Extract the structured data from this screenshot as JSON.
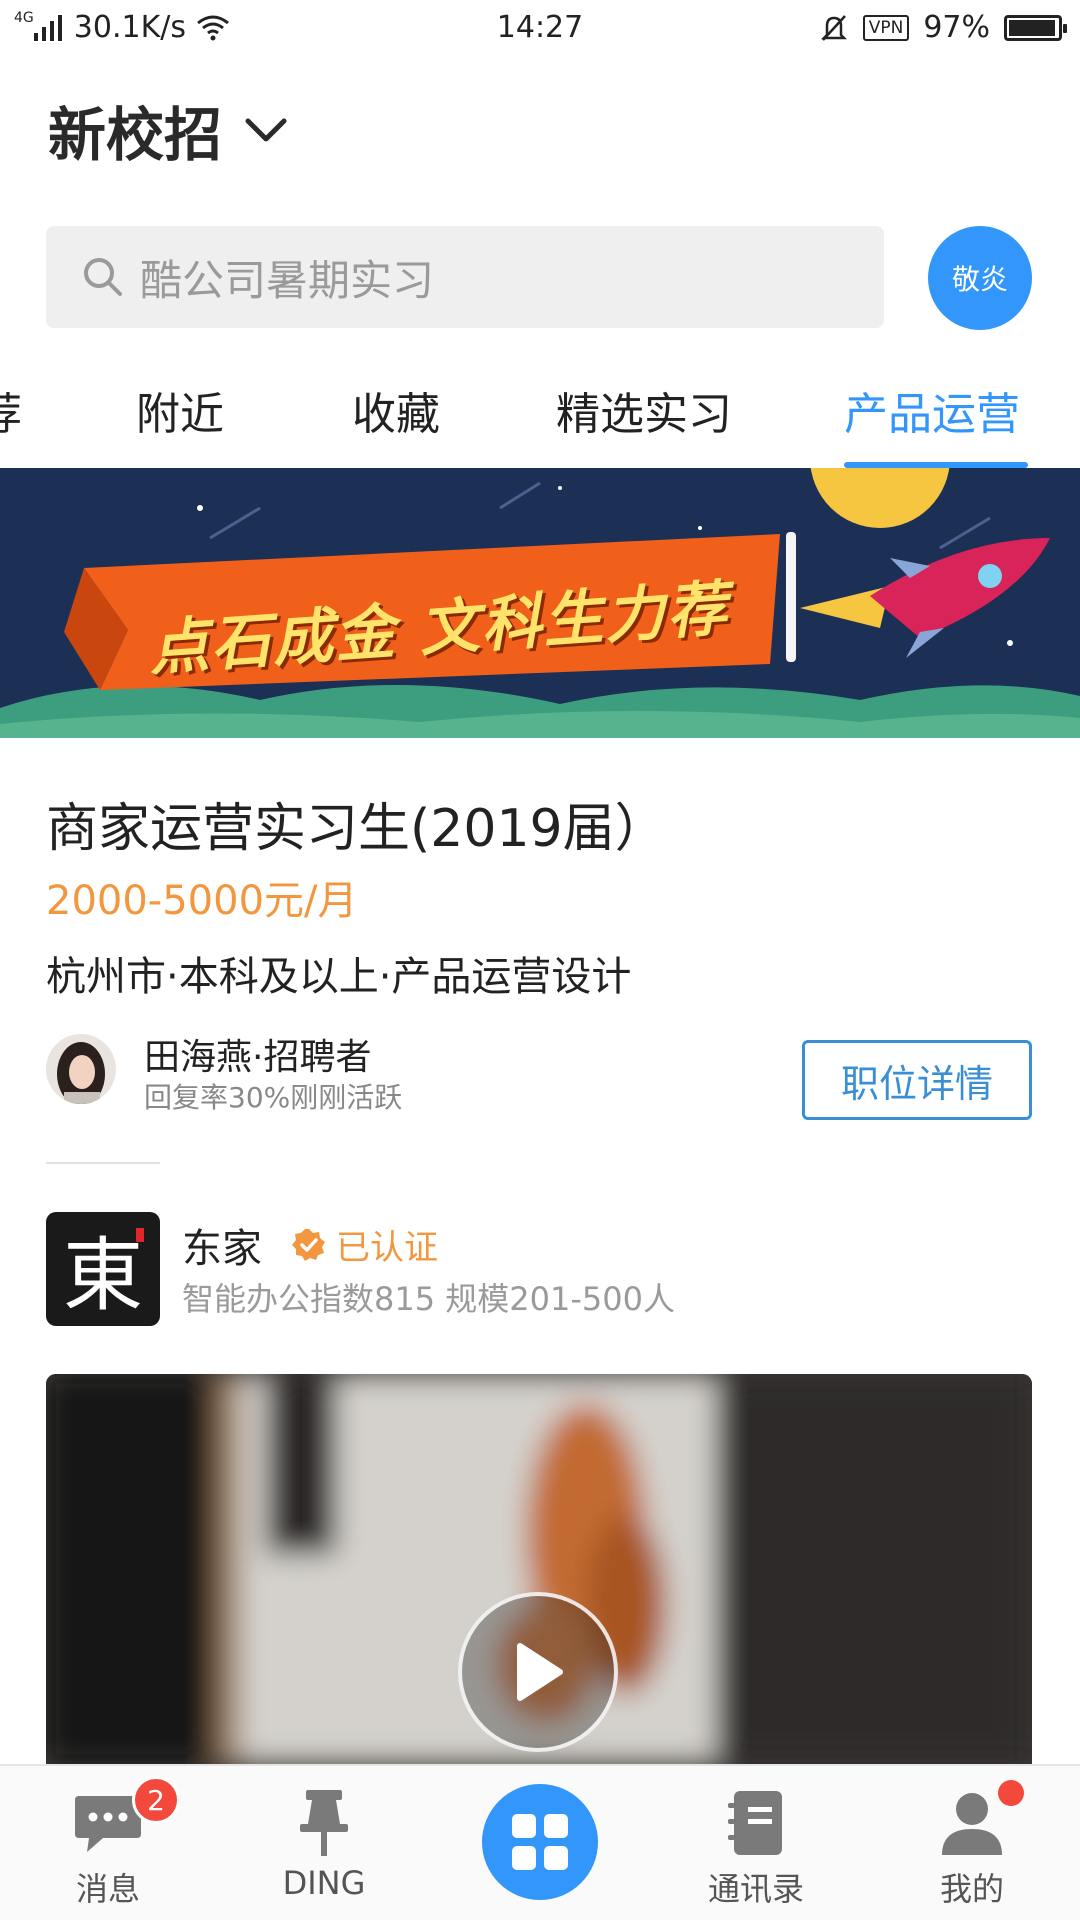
{
  "status_bar": {
    "network": "4G",
    "speed": "30.1K/s",
    "time": "14:27",
    "vpn": "VPN",
    "battery_text": "97%",
    "battery_level": 0.97
  },
  "header": {
    "title": "新校招"
  },
  "search": {
    "placeholder": "酷公司暑期实习"
  },
  "user": {
    "avatar_text": "敬炎"
  },
  "tabs": [
    {
      "label": "荐"
    },
    {
      "label": "附近"
    },
    {
      "label": "收藏"
    },
    {
      "label": "精选实习"
    },
    {
      "label": "产品运营",
      "active": true
    }
  ],
  "banner": {
    "text": "点石成金 文科生力荐"
  },
  "job": {
    "title": "商家运营实习生(2019届）",
    "salary": "2000-5000元/月",
    "meta": "杭州市·本科及以上·产品运营设计",
    "recruiter_name": "田海燕·招聘者",
    "recruiter_status": "回复率30%刚刚活跃",
    "detail_button": "职位详情"
  },
  "company": {
    "logo_text": "東",
    "name": "东家",
    "verified_label": "已认证",
    "info": "智能办公指数815 规模201-500人"
  },
  "bottom_nav": {
    "items": [
      {
        "label": "消息",
        "badge": "2"
      },
      {
        "label": "DING"
      },
      {
        "label": "通讯录"
      },
      {
        "label": "我的"
      }
    ]
  },
  "colors": {
    "accent": "#3296fa",
    "salary": "#f3973f",
    "badge": "#f3493d"
  }
}
